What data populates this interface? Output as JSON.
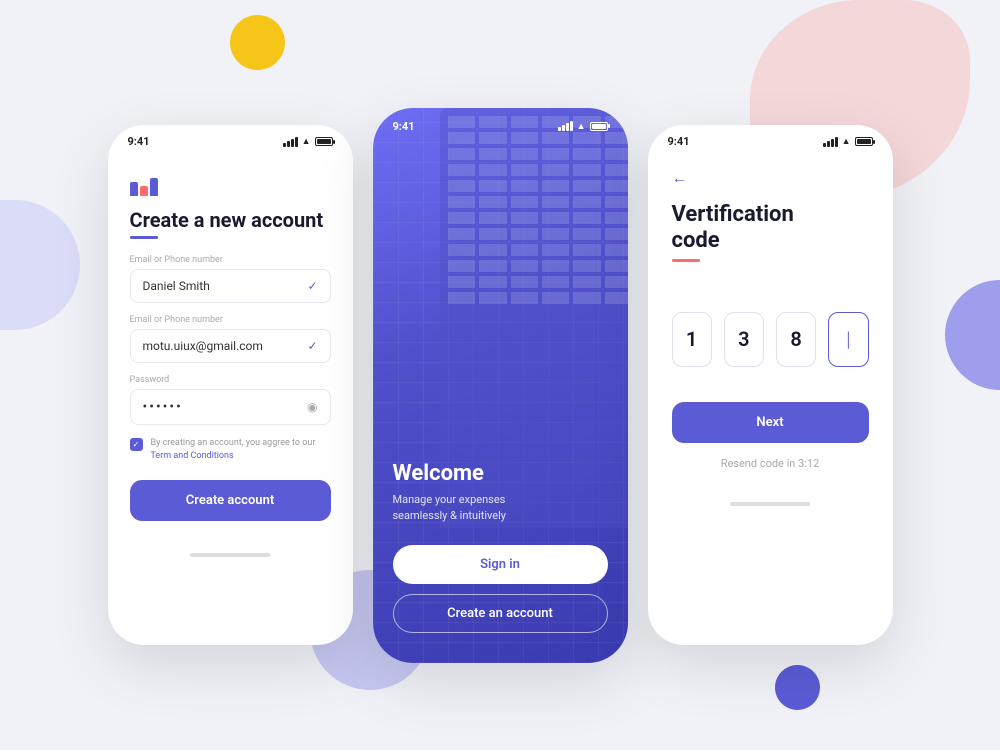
{
  "bg": {
    "yellow_circle": "decorative",
    "pink_blob": "decorative",
    "purple_left": "decorative",
    "purple_bottom": "decorative",
    "purple_right": "decorative",
    "purple_br": "decorative"
  },
  "phone_left": {
    "status_time": "9:41",
    "logo_label": "app-logo",
    "title": "Create a new account",
    "field1_label": "Email or Phone number",
    "field1_value": "Daniel Smith",
    "field2_label": "Email or Phone number",
    "field2_value": "motu.uiux@gmail.com",
    "field3_label": "Password",
    "field3_value": "••••••",
    "terms_text": "By creating an account, you aggree to our",
    "terms_link": "Term and Conditions",
    "create_btn": "Create account"
  },
  "phone_middle": {
    "status_time": "9:41",
    "welcome_title": "Welcome",
    "welcome_sub_line1": "Manage your expenses",
    "welcome_sub_line2": "seamlessly & intuitively",
    "signin_btn": "Sign in",
    "create_account_btn": "Create an account"
  },
  "phone_right": {
    "status_time": "9:41",
    "back_icon": "←",
    "title_line1": "Vertification",
    "title_line2": "code",
    "code_digits": [
      "1",
      "3",
      "8",
      "|"
    ],
    "next_btn": "Next",
    "resend_text": "Resend code in 3:12"
  }
}
